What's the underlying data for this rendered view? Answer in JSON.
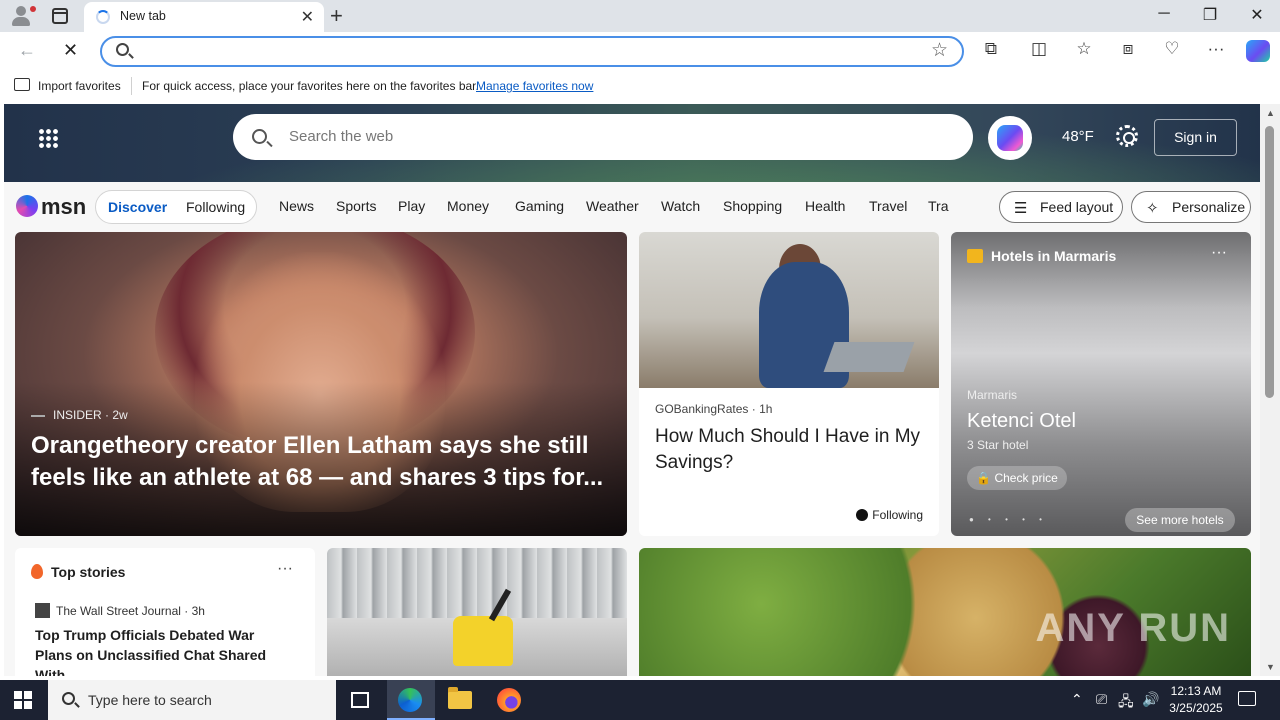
{
  "browser": {
    "tab_title": "New tab",
    "tab_close": "✕",
    "new_tab": "+",
    "window_controls": [
      "─",
      "❐",
      "✕"
    ]
  },
  "toolbar": {
    "address_value": "",
    "icons": [
      "back-icon",
      "reload-icon",
      "extensions-icon",
      "split-screen-icon",
      "favorites-icon",
      "collections-icon",
      "performance-icon",
      "more-icon",
      "copilot-icon"
    ]
  },
  "favorites_bar": {
    "import_label": "Import favorites",
    "message": "For quick access, place your favorites here on the favorites bar.",
    "manage_link": "Manage favorites now"
  },
  "msn": {
    "search_placeholder": "Search the web",
    "weather": "48°F",
    "sign_in": "Sign in",
    "logo_text": "msn",
    "pill": {
      "discover": "Discover",
      "following": "Following"
    },
    "categories": [
      "News",
      "Sports",
      "Play",
      "Money",
      "Gaming",
      "Weather",
      "Watch",
      "Shopping",
      "Health",
      "Travel",
      "Tra"
    ],
    "feed_layout": "Feed layout",
    "personalize": "Personalize"
  },
  "cards": {
    "hero": {
      "source": "INSIDER",
      "age": "2w",
      "headline": "Orangetheory creator Ellen Latham says she still feels like an athlete at 68 — and shares 3 tips for..."
    },
    "savings": {
      "source": "GOBankingRates",
      "age": "1h",
      "headline": "How Much Should I Have in My Savings?",
      "follow": "Following"
    },
    "hotels": {
      "header": "Hotels in Marmaris",
      "more": "···",
      "location": "Marmaris",
      "name": "Ketenci Otel",
      "stars": "3 Star hotel",
      "check_price": "Check price",
      "dots": "● • • • •",
      "see_more": "See more hotels"
    },
    "top_stories": {
      "header": "Top stories",
      "more": "···",
      "source": "The Wall Street Journal",
      "age": "3h",
      "headline": "Top Trump Officials Debated War Plans on Unclassified Chat Shared With..."
    },
    "watermark": "ANY RUN"
  },
  "taskbar": {
    "search_placeholder": "Type here to search",
    "time": "12:13 AM",
    "date": "3/25/2025",
    "tray_icons": [
      "chevron-up-icon",
      "usb-icon",
      "network-icon",
      "volume-icon"
    ]
  }
}
